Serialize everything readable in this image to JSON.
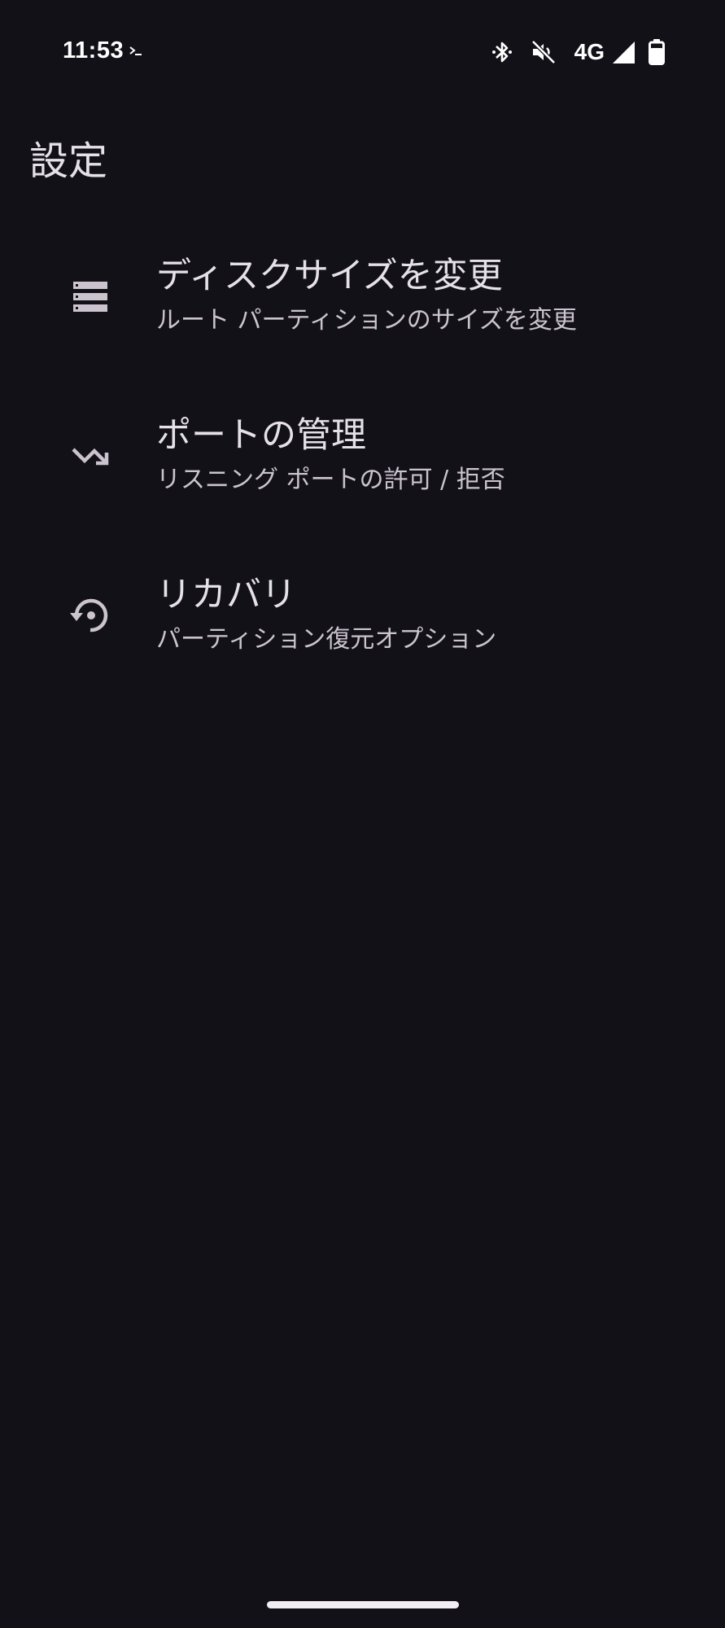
{
  "status_bar": {
    "time": "11:53",
    "network": "4G",
    "icons": [
      "terminal-icon",
      "bluetooth-icon",
      "mute-icon",
      "signal-icon",
      "battery-icon"
    ]
  },
  "page": {
    "title": "設定"
  },
  "settings": {
    "items": [
      {
        "icon": "storage-icon",
        "title": "ディスクサイズを変更",
        "subtitle": "ルート パーティションのサイズを変更"
      },
      {
        "icon": "port-arrow-icon",
        "title": "ポートの管理",
        "subtitle": "リスニング ポートの許可 / 拒否"
      },
      {
        "icon": "restore-icon",
        "title": "リカバリ",
        "subtitle": "パーティション復元オプション"
      }
    ]
  },
  "colors": {
    "background": "#131118",
    "primary_text": "#e6e1e8",
    "secondary_text": "#cbc4cf",
    "icon": "#cbc4cf"
  }
}
